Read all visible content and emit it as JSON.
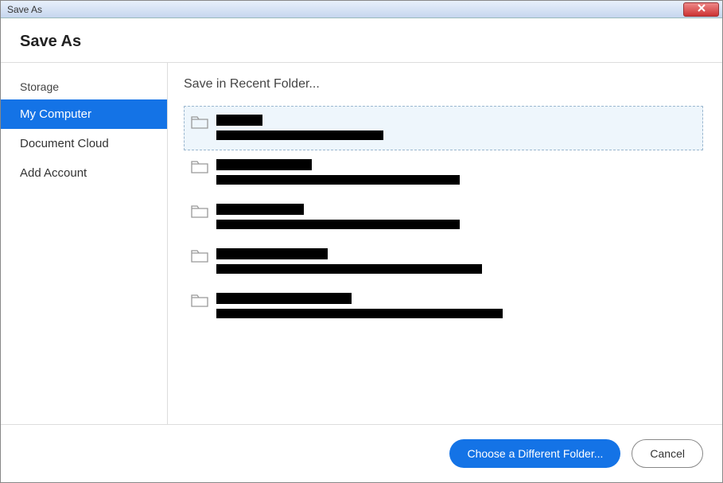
{
  "window": {
    "title": "Save As"
  },
  "header": {
    "title": "Save As"
  },
  "sidebar": {
    "label": "Storage",
    "items": [
      {
        "label": "My Computer",
        "active": true
      },
      {
        "label": "Document Cloud",
        "active": false
      },
      {
        "label": "Add Account",
        "active": false
      }
    ]
  },
  "main": {
    "heading": "Save in Recent Folder...",
    "folders": [
      {
        "name_redacted_width": 58,
        "path_redacted_width": 210,
        "selected": true
      },
      {
        "name_redacted_width": 120,
        "path_redacted_width": 306,
        "selected": false
      },
      {
        "name_redacted_width": 110,
        "path_redacted_width": 306,
        "selected": false
      },
      {
        "name_redacted_width": 140,
        "path_redacted_width": 334,
        "selected": false
      },
      {
        "name_redacted_width": 170,
        "path_redacted_width": 360,
        "selected": false
      }
    ]
  },
  "footer": {
    "primary": "Choose a Different Folder...",
    "secondary": "Cancel"
  }
}
